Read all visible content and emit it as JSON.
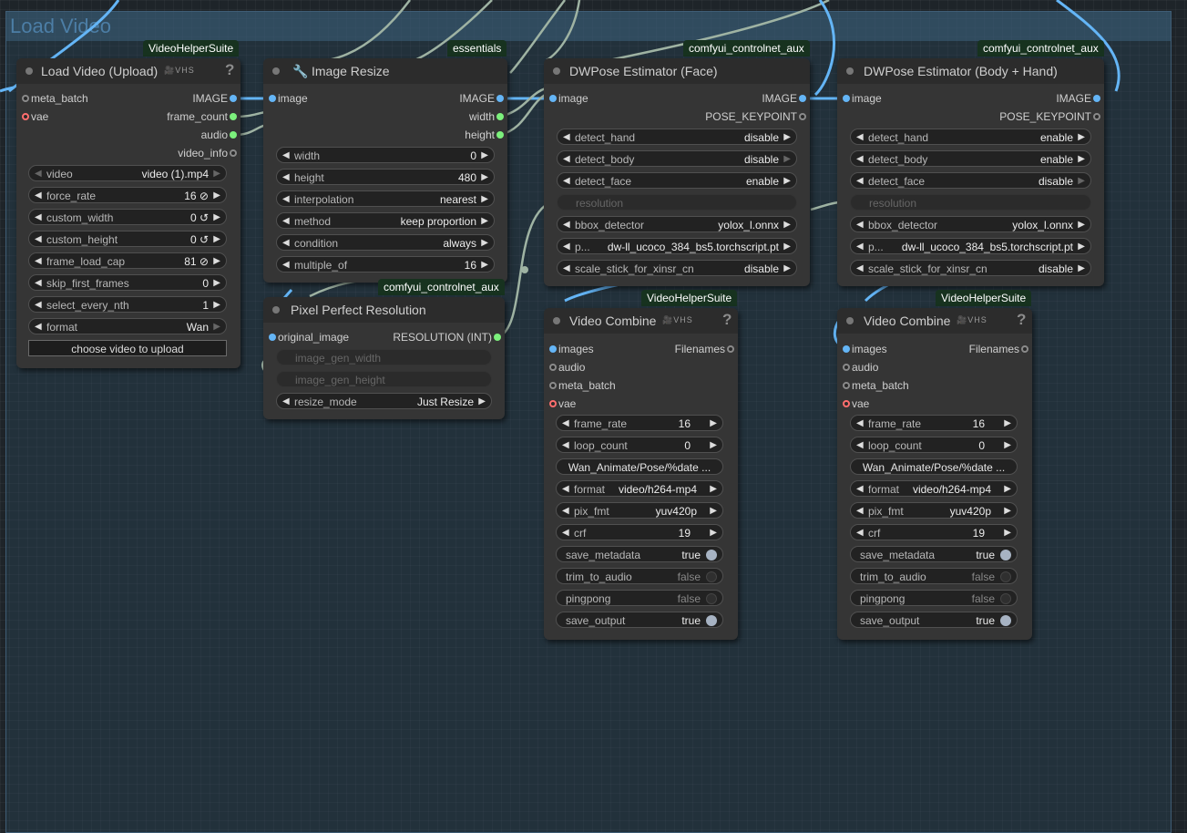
{
  "group": {
    "title": "Load Video"
  },
  "nodes": {
    "load_video": {
      "badge": "VideoHelperSuite",
      "title": "Load Video (Upload)",
      "vhs": "🎥VHS",
      "help": "?",
      "inputs": [
        "meta_batch",
        "vae"
      ],
      "outputs": [
        "IMAGE",
        "frame_count",
        "audio",
        "video_info"
      ],
      "widgets": [
        {
          "name": "video",
          "value": "video (1).mp4"
        },
        {
          "name": "force_rate",
          "value": "16 ⊘"
        },
        {
          "name": "custom_width",
          "value": "0 ↺"
        },
        {
          "name": "custom_height",
          "value": "0 ↺"
        },
        {
          "name": "frame_load_cap",
          "value": "81 ⊘"
        },
        {
          "name": "skip_first_frames",
          "value": "0"
        },
        {
          "name": "select_every_nth",
          "value": "1"
        },
        {
          "name": "format",
          "value": "Wan"
        }
      ],
      "upload_button": "choose video to upload"
    },
    "image_resize": {
      "badge": "essentials",
      "title": "Image Resize",
      "icon": "🔧",
      "inputs": [
        "image"
      ],
      "outputs": [
        "IMAGE",
        "width",
        "height"
      ],
      "widgets": [
        {
          "name": "width",
          "value": "0"
        },
        {
          "name": "height",
          "value": "480"
        },
        {
          "name": "interpolation",
          "value": "nearest"
        },
        {
          "name": "method",
          "value": "keep proportion"
        },
        {
          "name": "condition",
          "value": "always"
        },
        {
          "name": "multiple_of",
          "value": "16"
        }
      ]
    },
    "pixel_perfect": {
      "badge": "comfyui_controlnet_aux",
      "title": "Pixel Perfect Resolution",
      "inputs": [
        "original_image",
        "image_gen_width",
        "image_gen_height"
      ],
      "outputs": [
        "RESOLUTION (INT)"
      ],
      "widgets": [
        {
          "name": "resize_mode",
          "value": "Just Resize"
        }
      ]
    },
    "dwpose_face": {
      "badge": "comfyui_controlnet_aux",
      "title": "DWPose Estimator (Face)",
      "inputs": [
        "image"
      ],
      "outputs": [
        "IMAGE",
        "POSE_KEYPOINT"
      ],
      "widgets": [
        {
          "name": "detect_hand",
          "value": "disable"
        },
        {
          "name": "detect_body",
          "value": "disable"
        },
        {
          "name": "detect_face",
          "value": "enable"
        },
        {
          "name": "resolution",
          "value": ""
        },
        {
          "name": "bbox_detector",
          "value": "yolox_l.onnx"
        },
        {
          "name": "p...",
          "value": "dw-ll_ucoco_384_bs5.torchscript.pt"
        },
        {
          "name": "scale_stick_for_xinsr_cn",
          "value": "disable"
        }
      ]
    },
    "dwpose_body": {
      "badge": "comfyui_controlnet_aux",
      "title": "DWPose Estimator (Body + Hand)",
      "inputs": [
        "image"
      ],
      "outputs": [
        "IMAGE",
        "POSE_KEYPOINT"
      ],
      "widgets": [
        {
          "name": "detect_hand",
          "value": "enable"
        },
        {
          "name": "detect_body",
          "value": "enable"
        },
        {
          "name": "detect_face",
          "value": "disable"
        },
        {
          "name": "resolution",
          "value": ""
        },
        {
          "name": "bbox_detector",
          "value": "yolox_l.onnx"
        },
        {
          "name": "p...",
          "value": "dw-ll_ucoco_384_bs5.torchscript.pt"
        },
        {
          "name": "scale_stick_for_xinsr_cn",
          "value": "disable"
        }
      ]
    },
    "video_combine_1": {
      "badge": "VideoHelperSuite",
      "title": "Video Combine",
      "vhs": "🎥VHS",
      "help": "?",
      "inputs": [
        "images",
        "audio",
        "meta_batch",
        "vae"
      ],
      "outputs": [
        "Filenames"
      ],
      "widgets": [
        {
          "name": "frame_rate",
          "value": "16"
        },
        {
          "name": "loop_count",
          "value": "0"
        },
        {
          "name": "filename_prefix",
          "value": "Wan_Animate/Pose/%date ..."
        },
        {
          "name": "format",
          "value": "video/h264-mp4"
        },
        {
          "name": "pix_fmt",
          "value": "yuv420p"
        },
        {
          "name": "crf",
          "value": "19"
        },
        {
          "name": "save_metadata",
          "value": "true"
        },
        {
          "name": "trim_to_audio",
          "value": "false"
        },
        {
          "name": "pingpong",
          "value": "false"
        },
        {
          "name": "save_output",
          "value": "true"
        }
      ]
    },
    "video_combine_2": {
      "badge": "VideoHelperSuite",
      "title": "Video Combine",
      "vhs": "🎥VHS",
      "help": "?",
      "inputs": [
        "images",
        "audio",
        "meta_batch",
        "vae"
      ],
      "outputs": [
        "Filenames"
      ],
      "widgets": [
        {
          "name": "frame_rate",
          "value": "16"
        },
        {
          "name": "loop_count",
          "value": "0"
        },
        {
          "name": "filename_prefix",
          "value": "Wan_Animate/Pose/%date ..."
        },
        {
          "name": "format",
          "value": "video/h264-mp4"
        },
        {
          "name": "pix_fmt",
          "value": "yuv420p"
        },
        {
          "name": "crf",
          "value": "19"
        },
        {
          "name": "save_metadata",
          "value": "true"
        },
        {
          "name": "trim_to_audio",
          "value": "false"
        },
        {
          "name": "pingpong",
          "value": "false"
        },
        {
          "name": "save_output",
          "value": "true"
        }
      ]
    }
  },
  "colors": {
    "image_link": "#64b5f6",
    "int_link": "#9fb3a3",
    "badge_bg": "#17321f",
    "group_title": "#4c7ea6"
  }
}
